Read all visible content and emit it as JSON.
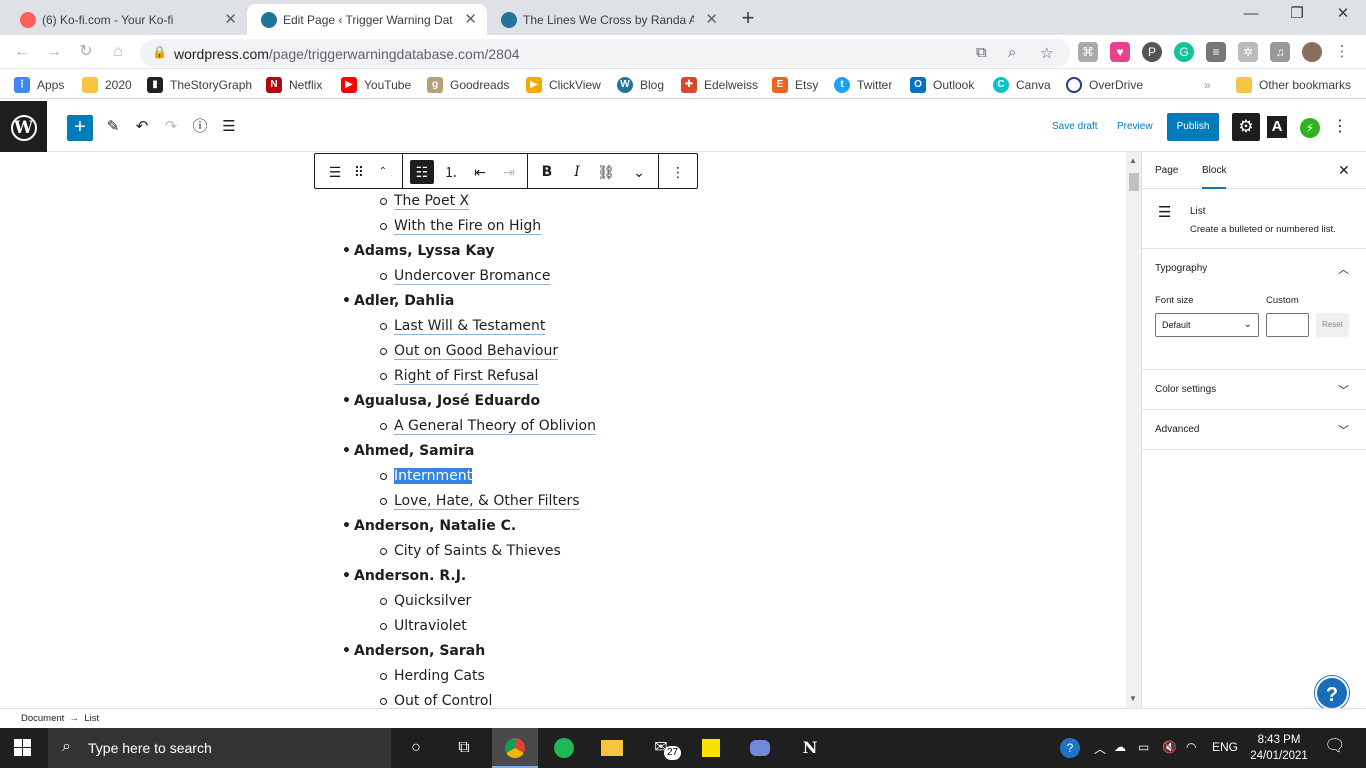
{
  "browser": {
    "tabs": [
      {
        "title": "(6) Ko-fi.com - Your Ko-fi",
        "active": false
      },
      {
        "title": "Edit Page ‹ Trigger Warning Data",
        "active": true
      },
      {
        "title": "The Lines We Cross by Randa Ab",
        "active": false
      }
    ],
    "url_host": "wordpress.com",
    "url_path": "/page/triggerwarningdatabase.com/2804",
    "bookmarks": [
      "Apps",
      "2020",
      "TheStoryGraph",
      "Netflix",
      "YouTube",
      "Goodreads",
      "ClickView",
      "Blog",
      "Edelweiss",
      "Etsy",
      "Twitter",
      "Outlook",
      "Canva",
      "OverDrive"
    ],
    "other_bookmarks": "Other bookmarks"
  },
  "wp_toolbar": {
    "save_draft": "Save draft",
    "preview": "Preview",
    "publish": "Publish",
    "typography_label": "A"
  },
  "list": [
    {
      "text": "The Poet X",
      "level": 2,
      "link": true
    },
    {
      "text": "With the Fire on High",
      "level": 2,
      "link": true
    },
    {
      "text": "Adams, Lyssa Kay",
      "level": 1
    },
    {
      "text": "Undercover Bromance",
      "level": 2,
      "link": true
    },
    {
      "text": "Adler, Dahlia",
      "level": 1
    },
    {
      "text": "Last Will & Testament",
      "level": 2,
      "link": true
    },
    {
      "text": "Out on Good Behaviour",
      "level": 2,
      "link": true
    },
    {
      "text": "Right of First Refusal",
      "level": 2,
      "link": true
    },
    {
      "text": "Agualusa, José Eduardo",
      "level": 1
    },
    {
      "text": "A General Theory of Oblivion",
      "level": 2,
      "link": true
    },
    {
      "text": "Ahmed, Samira",
      "level": 1
    },
    {
      "text": "Internment",
      "level": 2,
      "link": true,
      "selected": true
    },
    {
      "text": "Love, Hate, & Other Filters",
      "level": 2,
      "link": true
    },
    {
      "text": "Anderson, Natalie C.",
      "level": 1
    },
    {
      "text": "City of Saints & Thieves",
      "level": 2,
      "link": false
    },
    {
      "text": "Anderson. R.J.",
      "level": 1
    },
    {
      "text": "Quicksilver",
      "level": 2,
      "link": false
    },
    {
      "text": "Ultraviolet",
      "level": 2,
      "link": false
    },
    {
      "text": "Anderson, Sarah",
      "level": 1
    },
    {
      "text": "Herding Cats",
      "level": 2,
      "link": false
    },
    {
      "text": "Out of Control",
      "level": 2,
      "link": false
    }
  ],
  "sidebar": {
    "tab_page": "Page",
    "tab_block": "Block",
    "block_name": "List",
    "block_desc": "Create a bulleted or numbered list.",
    "typography": "Typography",
    "font_size_label": "Font size",
    "custom_label": "Custom",
    "font_size_value": "Default",
    "reset": "Reset",
    "color_settings": "Color settings",
    "advanced": "Advanced",
    "help": "?"
  },
  "footer": {
    "breadcrumb": "Document  →  List"
  },
  "taskbar": {
    "search_placeholder": "Type here to search",
    "mail_badge": "27",
    "lang": "ENG",
    "time": "8:43 PM",
    "date": "24/01/2021"
  }
}
